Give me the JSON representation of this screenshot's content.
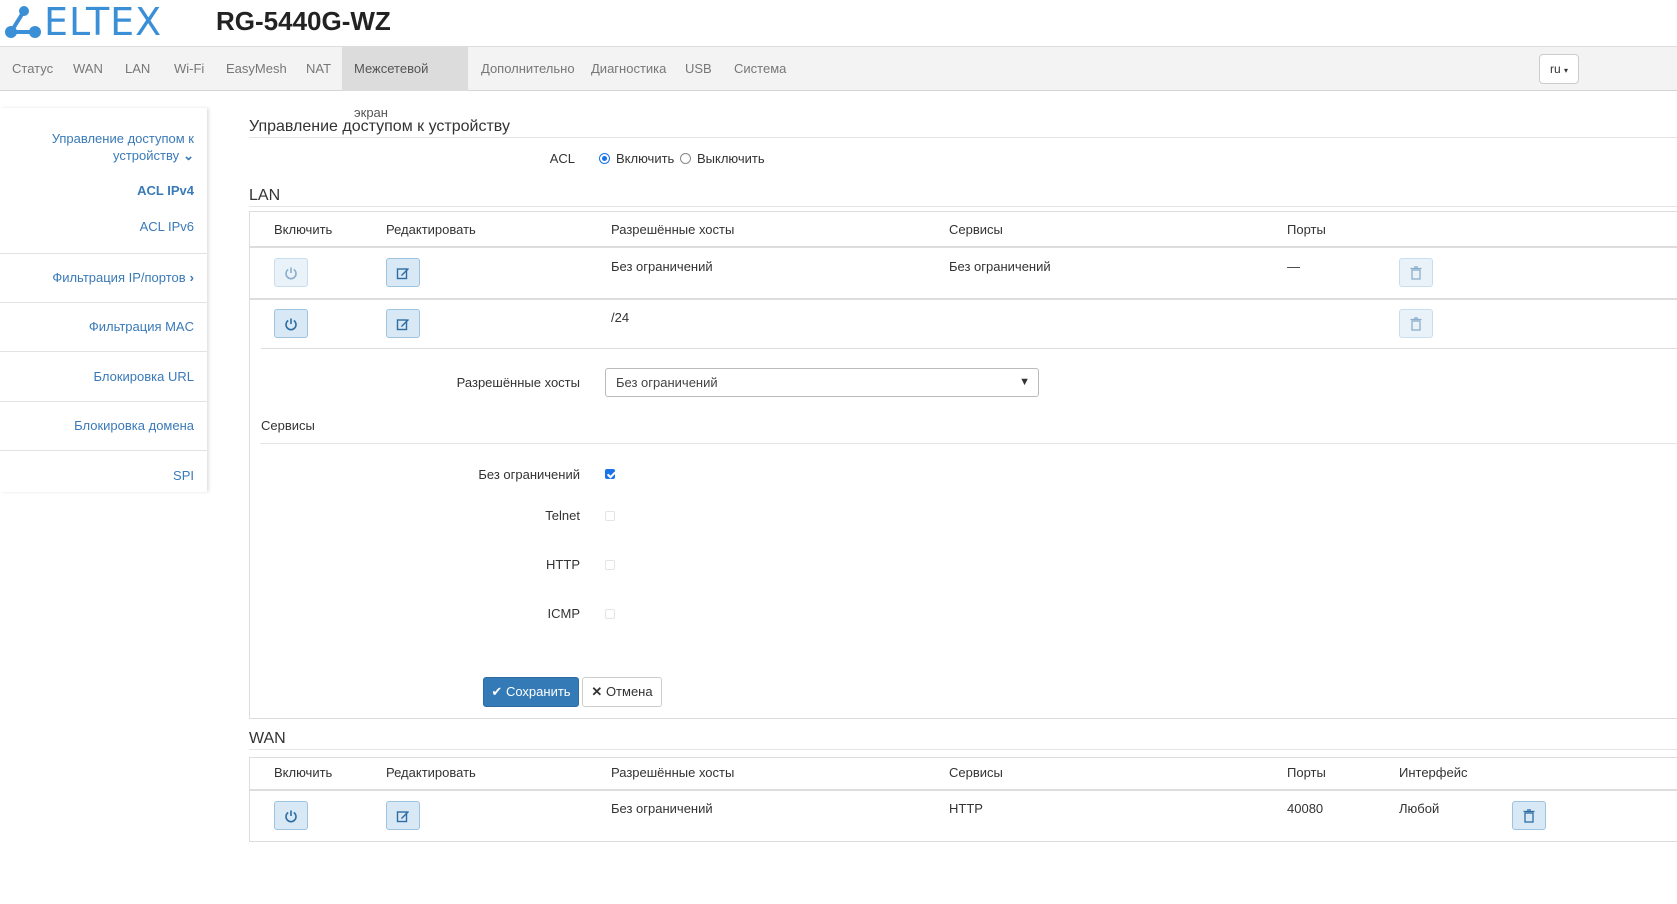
{
  "header": {
    "logo_text": "ELTEX",
    "model": "RG-5440G-WZ"
  },
  "nav": {
    "items": [
      "Статус",
      "WAN",
      "LAN",
      "Wi-Fi",
      "EasyMesh",
      "NAT",
      "Межсетевой экран",
      "Дополнительно",
      "Диагностика",
      "USB",
      "Система"
    ],
    "active": "Межсетевой экран",
    "lang": "ru"
  },
  "sidebar": {
    "group_title": "Управление доступом к устройству",
    "group_title_line1": "Управление доступом к",
    "group_title_line2": "устройству",
    "acl_ipv4": "ACL IPv4",
    "acl_ipv6": "ACL IPv6",
    "ip_port_filter": "Фильтрация IP/портов",
    "mac_filter": "Фильтрация MAC",
    "url_block": "Блокировка URL",
    "domain_block": "Блокировка домена",
    "spi": "SPI"
  },
  "main": {
    "title": "Управление доступом к устройству",
    "acl_label": "ACL",
    "acl_enable": "Включить",
    "acl_disable": "Выключить",
    "acl_selected": "Включить"
  },
  "lan": {
    "title": "LAN",
    "headers": {
      "enable": "Включить",
      "edit": "Редактировать",
      "hosts": "Разрешённые хосты",
      "services": "Сервисы",
      "ports": "Порты"
    },
    "rows": [
      {
        "hosts": "Без ограничений",
        "services": "Без ограничений",
        "ports": "—"
      },
      {
        "hosts": "/24",
        "services": "",
        "ports": ""
      }
    ],
    "edit_form": {
      "hosts_label": "Разрешённые хосты",
      "hosts_value": "Без ограничений",
      "services_title": "Сервисы",
      "services": [
        {
          "label": "Без ограничений",
          "checked": true
        },
        {
          "label": "Telnet",
          "checked": false
        },
        {
          "label": "HTTP",
          "checked": false
        },
        {
          "label": "ICMP",
          "checked": false
        }
      ],
      "save": "Сохранить",
      "cancel": "Отмена"
    }
  },
  "wan": {
    "title": "WAN",
    "headers": {
      "enable": "Включить",
      "edit": "Редактировать",
      "hosts": "Разрешённые хосты",
      "services": "Сервисы",
      "ports": "Порты",
      "interface": "Интерфейс"
    },
    "rows": [
      {
        "hosts": "Без ограничений",
        "services": "HTTP",
        "ports": "40080",
        "interface": "Любой"
      }
    ]
  },
  "colors": {
    "accent": "#337ab7",
    "link": "#3a7ab8",
    "logo": "#3b8fd6"
  }
}
